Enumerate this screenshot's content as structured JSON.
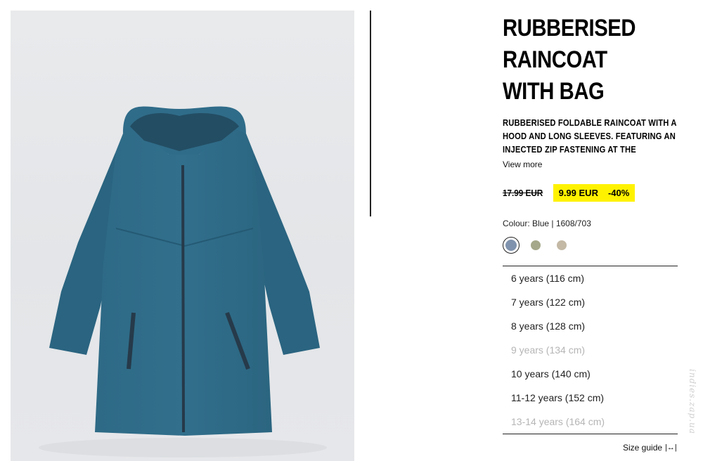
{
  "product": {
    "title": "RUBBERISED RAINCOAT WITH BAG",
    "description": "RUBBERISED FOLDABLE RAINCOAT WITH A HOOD AND LONG SLEEVES. FEATURING AN INJECTED ZIP FASTENING AT THE",
    "view_more": "View more",
    "old_price": "17.99 EUR",
    "new_price": "9.99 EUR",
    "discount": "-40%",
    "colour_label": "Colour: Blue | 1608/703",
    "colours": [
      {
        "name": "blue",
        "hex": "#7f93ae",
        "selected": true
      },
      {
        "name": "khaki",
        "hex": "#a5a88a",
        "selected": false
      },
      {
        "name": "beige",
        "hex": "#c3b9a5",
        "selected": false
      }
    ],
    "sizes": [
      {
        "label": "6 years (116 cm)",
        "available": true
      },
      {
        "label": "7 years (122 cm)",
        "available": true
      },
      {
        "label": "8 years (128 cm)",
        "available": true
      },
      {
        "label": "9 years (134 cm)",
        "available": false
      },
      {
        "label": "10 years (140 cm)",
        "available": true
      },
      {
        "label": "11-12 years (152 cm)",
        "available": true
      },
      {
        "label": "13-14 years (164 cm)",
        "available": false
      }
    ],
    "size_guide": "Size guide",
    "size_guide_icon": "ruler-icon",
    "image_icon": "raincoat-image",
    "accent_color": "#fff200"
  },
  "watermark": "indies.zap.ua"
}
